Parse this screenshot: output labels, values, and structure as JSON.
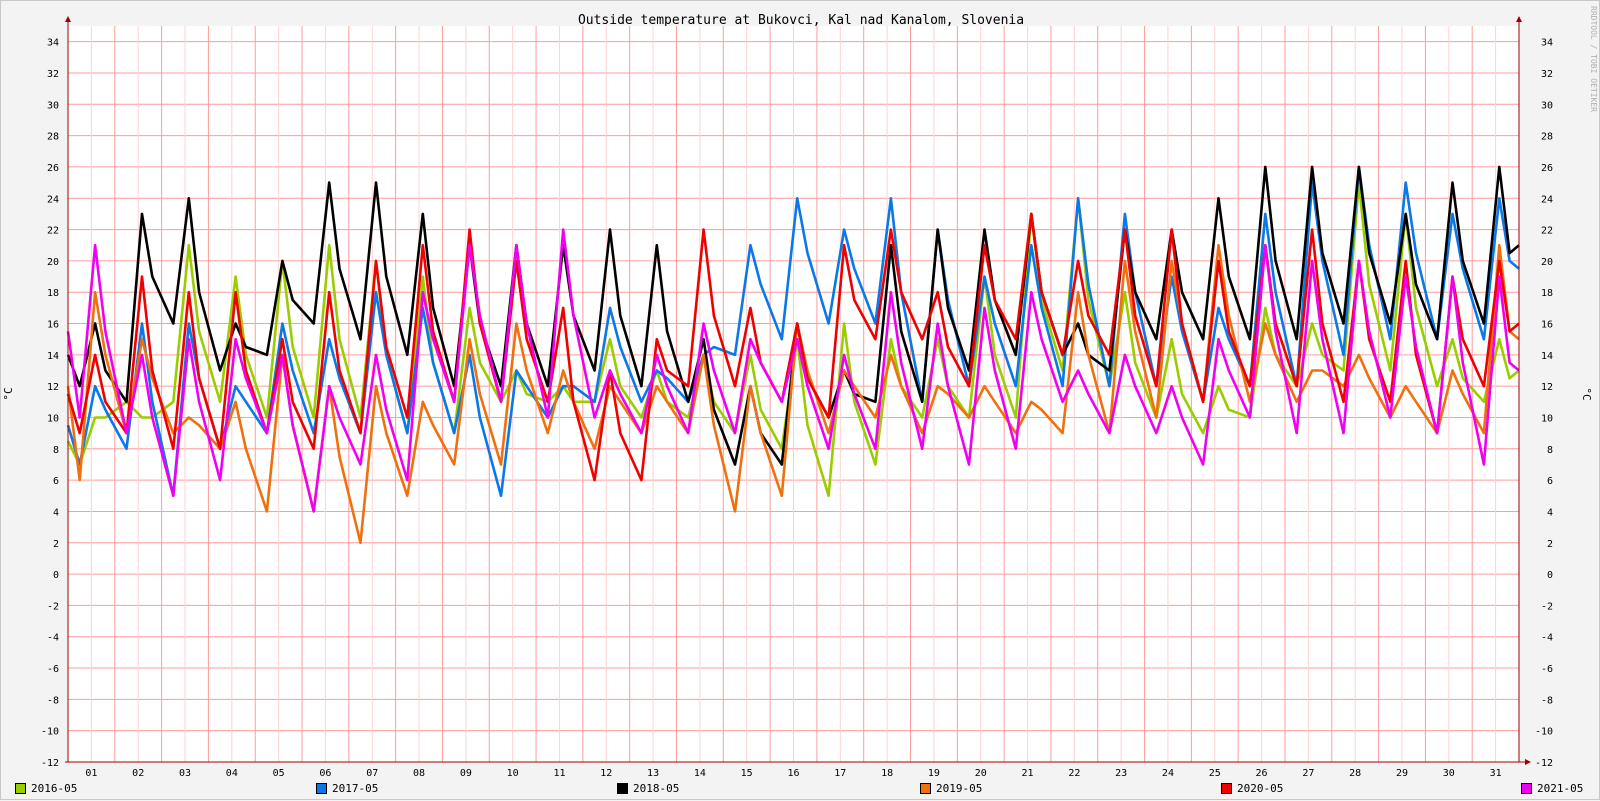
{
  "watermark": "RRDTOOL / TOBI OETIKER",
  "chart_data": {
    "type": "line",
    "title": "Outside temperature at Bukovci, Kal nad Kanalom, Slovenia",
    "ylabel": "°C",
    "ylabel_right": "°C",
    "ylim": [
      -12,
      35
    ],
    "yticks": [
      -12,
      -10,
      -8,
      -6,
      -4,
      -2,
      0,
      2,
      4,
      6,
      8,
      10,
      12,
      14,
      16,
      18,
      20,
      22,
      24,
      26,
      28,
      30,
      32,
      34
    ],
    "xlim": [
      0.5,
      31.5
    ],
    "xticks": [
      "01",
      "02",
      "03",
      "04",
      "05",
      "06",
      "07",
      "08",
      "09",
      "10",
      "11",
      "12",
      "13",
      "14",
      "15",
      "16",
      "17",
      "18",
      "19",
      "20",
      "21",
      "22",
      "23",
      "24",
      "25",
      "26",
      "27",
      "28",
      "29",
      "30",
      "31"
    ],
    "xlabel": "",
    "grid": true,
    "legend_position": "bottom",
    "colors": {
      "background": "#f3f3f3",
      "canvas": "#ffffff",
      "grid_major": "#ff9c9c",
      "grid_minor": "#ffd2d2",
      "axis": "#a00000",
      "text": "#000000"
    },
    "series": [
      {
        "name": "2016-05",
        "color": "#9acd00",
        "max": [
          10,
          10,
          21,
          19,
          20,
          21,
          20,
          19,
          17,
          13,
          12,
          15,
          13,
          14,
          14,
          15,
          16,
          15,
          15,
          19,
          23,
          24,
          18,
          15,
          12,
          17,
          16,
          25,
          23,
          15,
          15
        ],
        "min": [
          7,
          11,
          11,
          11,
          10,
          10,
          10,
          9,
          9,
          11,
          11,
          11,
          10,
          10,
          9,
          8,
          5,
          7,
          10,
          10,
          10,
          13,
          12,
          10,
          9,
          10,
          12,
          13,
          13,
          12,
          11
        ]
      },
      {
        "name": "2017-05",
        "color": "#0a78e8",
        "max": [
          12,
          16,
          16,
          12,
          16,
          15,
          18,
          17,
          14,
          13,
          12,
          17,
          13,
          14,
          21,
          24,
          22,
          24,
          22,
          19,
          21,
          24,
          23,
          19,
          17,
          23,
          25,
          26,
          25,
          23,
          24
        ],
        "min": [
          7,
          8,
          5,
          8,
          9,
          9,
          9,
          9,
          9,
          5,
          10,
          11,
          11,
          11,
          14,
          15,
          16,
          16,
          11,
          12,
          12,
          12,
          12,
          12,
          11,
          12,
          12,
          14,
          15,
          15,
          15
        ]
      },
      {
        "name": "2018-05",
        "color": "#000000",
        "max": [
          16,
          23,
          24,
          16,
          20,
          25,
          25,
          23,
          21,
          21,
          21,
          22,
          21,
          15,
          12,
          16,
          13,
          21,
          22,
          22,
          23,
          16,
          22,
          22,
          24,
          26,
          26,
          26,
          23,
          25,
          26
        ],
        "min": [
          12,
          11,
          16,
          13,
          14,
          16,
          15,
          14,
          12,
          12,
          12,
          13,
          12,
          11,
          7,
          7,
          10,
          11,
          11,
          13,
          14,
          14,
          13,
          15,
          15,
          15,
          15,
          16,
          16,
          15,
          16
        ]
      },
      {
        "name": "2019-05",
        "color": "#f07010",
        "max": [
          18,
          15,
          10,
          11,
          14,
          12,
          12,
          11,
          15,
          16,
          13,
          12,
          12,
          14,
          12,
          16,
          13,
          14,
          12,
          12,
          11,
          18,
          20,
          20,
          21,
          16,
          13,
          14,
          12,
          13,
          21
        ],
        "min": [
          6,
          9,
          9,
          8,
          4,
          4,
          2,
          5,
          7,
          7,
          9,
          8,
          9,
          9,
          4,
          5,
          9,
          10,
          9,
          10,
          9,
          9,
          9,
          10,
          11,
          11,
          11,
          12,
          10,
          9,
          9
        ]
      },
      {
        "name": "2020-05",
        "color": "#f00000",
        "max": [
          14,
          19,
          18,
          18,
          15,
          18,
          20,
          21,
          22,
          20,
          17,
          13,
          15,
          22,
          17,
          16,
          21,
          22,
          18,
          21,
          23,
          20,
          22,
          22,
          20,
          21,
          22,
          20,
          20,
          19,
          20
        ],
        "min": [
          9,
          9,
          8,
          8,
          9,
          8,
          9,
          10,
          11,
          11,
          11,
          6,
          6,
          12,
          12,
          11,
          10,
          15,
          15,
          12,
          15,
          14,
          14,
          12,
          11,
          12,
          12,
          11,
          11,
          9,
          12
        ]
      },
      {
        "name": "2021-05",
        "color": "#f000f0",
        "max": [
          21,
          14,
          15,
          15,
          14,
          12,
          14,
          18,
          21,
          21,
          22,
          13,
          14,
          16,
          15,
          15,
          14,
          18,
          16,
          17,
          18,
          13,
          14,
          12,
          15,
          21,
          20,
          20,
          19,
          19,
          19
        ],
        "min": [
          10,
          9,
          5,
          6,
          9,
          4,
          7,
          6,
          11,
          11,
          10,
          10,
          9,
          9,
          9,
          11,
          8,
          8,
          8,
          7,
          8,
          11,
          9,
          9,
          7,
          10,
          9,
          9,
          10,
          9,
          7
        ]
      }
    ]
  }
}
